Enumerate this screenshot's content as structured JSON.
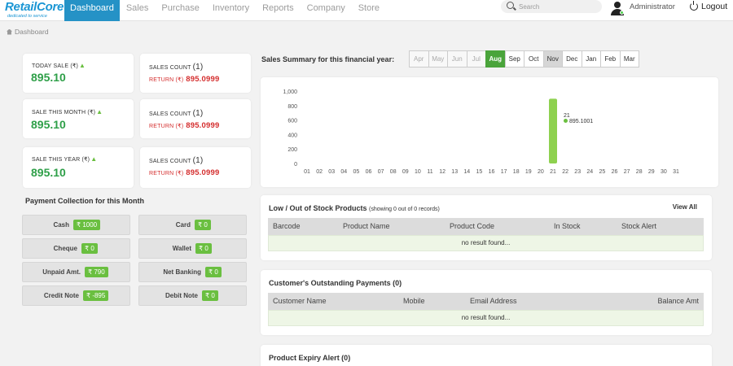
{
  "brand": {
    "name": "RetailCore",
    "tagline": "dedicated to service"
  },
  "nav": [
    "Dashboard",
    "Sales",
    "Purchase",
    "Inventory",
    "Reports",
    "Company",
    "Store"
  ],
  "search": {
    "placeholder": "Search"
  },
  "user": {
    "name": "Administrator",
    "logout": "Logout"
  },
  "breadcrumb": "Dashboard",
  "stats": [
    {
      "title": "TODAY SALE (₹)",
      "value": "895.10",
      "count_label": "SALES COUNT",
      "count": "(1)",
      "return_label": "RETURN (₹)",
      "return_value": "895.0999"
    },
    {
      "title": "SALE THIS MONTH (₹)",
      "value": "895.10",
      "count_label": "SALES COUNT",
      "count": "(1)",
      "return_label": "RETURN (₹)",
      "return_value": "895.0999"
    },
    {
      "title": "SALE THIS YEAR (₹)",
      "value": "895.10",
      "count_label": "SALES COUNT",
      "count": "(1)",
      "return_label": "RETURN (₹)",
      "return_value": "895.0999"
    }
  ],
  "payment": {
    "title": "Payment Collection for this Month",
    "items": [
      {
        "label": "Cash",
        "value": "₹ 1000"
      },
      {
        "label": "Card",
        "value": "₹ 0"
      },
      {
        "label": "Cheque",
        "value": "₹ 0"
      },
      {
        "label": "Wallet",
        "value": "₹ 0"
      },
      {
        "label": "Unpaid Amt.",
        "value": "₹ 790"
      },
      {
        "label": "Net Banking",
        "value": "₹ 0"
      },
      {
        "label": "Credit Note",
        "value": "₹ -895"
      },
      {
        "label": "Debit Note",
        "value": "₹ 0"
      }
    ]
  },
  "sales_summary": {
    "title": "Sales Summary for this financial year:",
    "months": [
      "Apr",
      "May",
      "Jun",
      "Jul",
      "Aug",
      "Sep",
      "Oct",
      "Nov",
      "Dec",
      "Jan",
      "Feb",
      "Mar"
    ],
    "selected": "Aug",
    "disabled": [
      "Apr",
      "May",
      "Jun",
      "Jul"
    ],
    "hover": "Nov"
  },
  "chart_data": {
    "type": "bar",
    "categories": [
      "01",
      "02",
      "03",
      "04",
      "05",
      "06",
      "07",
      "08",
      "09",
      "10",
      "11",
      "12",
      "13",
      "14",
      "15",
      "16",
      "17",
      "18",
      "19",
      "20",
      "21",
      "22",
      "23",
      "24",
      "25",
      "26",
      "27",
      "28",
      "29",
      "30",
      "31"
    ],
    "values": [
      0,
      0,
      0,
      0,
      0,
      0,
      0,
      0,
      0,
      0,
      0,
      0,
      0,
      0,
      0,
      0,
      0,
      0,
      0,
      0,
      895.1001,
      0,
      0,
      0,
      0,
      0,
      0,
      0,
      0,
      0,
      0
    ],
    "title": "",
    "xlabel": "",
    "ylabel": "",
    "ylim": [
      0,
      1000
    ],
    "yticks": [
      "0",
      "200",
      "400",
      "600",
      "800",
      "1,000"
    ],
    "color": "#8ed14f",
    "grid": false,
    "tooltip": {
      "label": "21",
      "value": "895.1001"
    }
  },
  "low_stock": {
    "title": "Low / Out of Stock Products",
    "subtitle": "(showing 0 out of 0 records)",
    "link": "View All",
    "columns": [
      "Barcode",
      "Product Name",
      "Product Code",
      "In Stock",
      "Stock Alert"
    ],
    "empty": "no result found..."
  },
  "outstanding": {
    "title": "Customer's Outstanding Payments (0)",
    "columns": [
      "Customer Name",
      "Mobile",
      "Email Address",
      "Balance Amt"
    ],
    "empty": "no result found..."
  },
  "expiry": {
    "title": "Product Expiry Alert (0)"
  }
}
